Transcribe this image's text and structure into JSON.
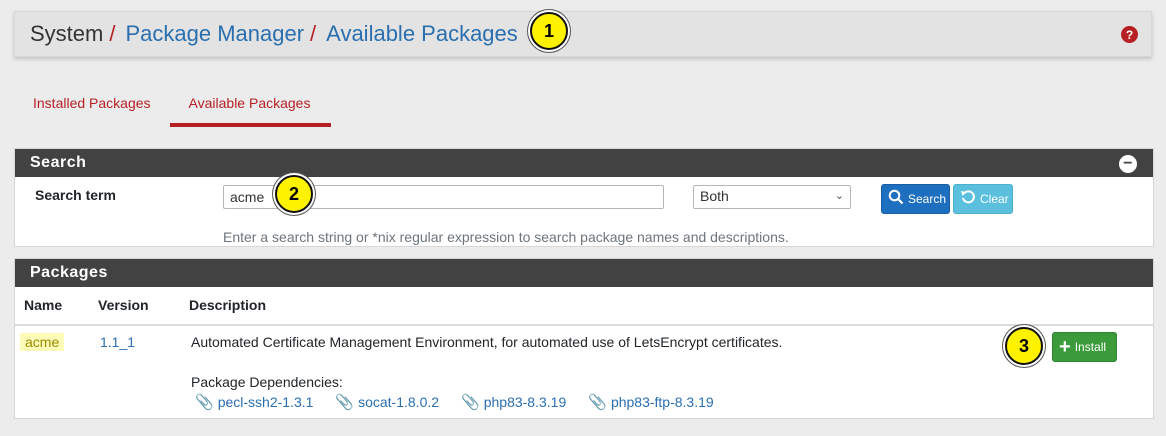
{
  "breadcrumb": {
    "root": "System",
    "separator": "/",
    "level2": "Package Manager",
    "level3": "Available Packages"
  },
  "help_icon": "?",
  "tabs": [
    {
      "label": "Installed Packages",
      "active": false
    },
    {
      "label": "Available Packages",
      "active": true
    }
  ],
  "search_panel": {
    "title": "Search",
    "collapse_symbol": "−",
    "term_label": "Search term",
    "term_value": "acme",
    "scope_selected": "Both",
    "search_button": "Search",
    "clear_button": "Clear",
    "help_text": "Enter a search string or *nix regular expression to search package names and descriptions."
  },
  "packages_panel": {
    "title": "Packages",
    "columns": [
      "Name",
      "Version",
      "Description"
    ],
    "rows": [
      {
        "name": "acme",
        "version": "1.1_1",
        "description": "Automated Certificate Management Environment, for automated use of LetsEncrypt certificates.",
        "dependencies_label": "Package Dependencies:",
        "dependencies": [
          "pecl-ssh2-1.3.1",
          "socat-1.8.0.2",
          "php83-8.3.19",
          "php83-ftp-8.3.19"
        ],
        "install_label": "Install"
      }
    ]
  },
  "annotations": [
    "1",
    "2",
    "3"
  ],
  "colors": {
    "accent_red": "#b62025",
    "link_blue": "#2a6fb0",
    "panel_header": "#424242",
    "search_button": "#1e6fc0",
    "clear_button": "#5bc0de",
    "install_button": "#3b9b3b",
    "badge_yellow": "#fff200"
  }
}
